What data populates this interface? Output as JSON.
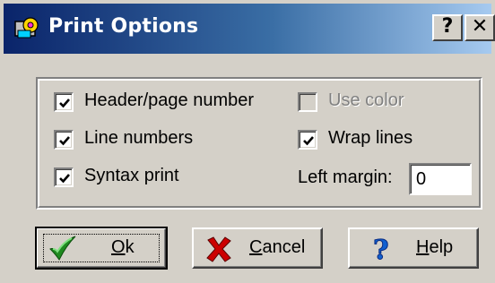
{
  "window": {
    "title": "Print Options",
    "help_button": "?",
    "close_button": "✕"
  },
  "options": {
    "header_page_number": {
      "label": "Header/page number",
      "checked": true,
      "enabled": true
    },
    "line_numbers": {
      "label": "Line numbers",
      "checked": true,
      "enabled": true
    },
    "syntax_print": {
      "label": "Syntax print",
      "checked": true,
      "enabled": true
    },
    "use_color": {
      "label": "Use color",
      "checked": false,
      "enabled": false
    },
    "wrap_lines": {
      "label": "Wrap lines",
      "checked": true,
      "enabled": true
    }
  },
  "left_margin": {
    "label": "Left margin:",
    "value": "0"
  },
  "buttons": {
    "ok": {
      "underlined": "O",
      "rest": "k"
    },
    "cancel": {
      "underlined": "C",
      "rest": "ancel"
    },
    "help": {
      "underlined": "H",
      "rest": "elp"
    }
  },
  "colors": {
    "titlebar_start": "#0a246a",
    "titlebar_end": "#a6caf0",
    "face": "#d4d0c8"
  },
  "icons": {
    "title": "gear-printer-icon",
    "ok": "checkmark-icon",
    "cancel": "cross-icon",
    "help": "question-mark-icon"
  }
}
